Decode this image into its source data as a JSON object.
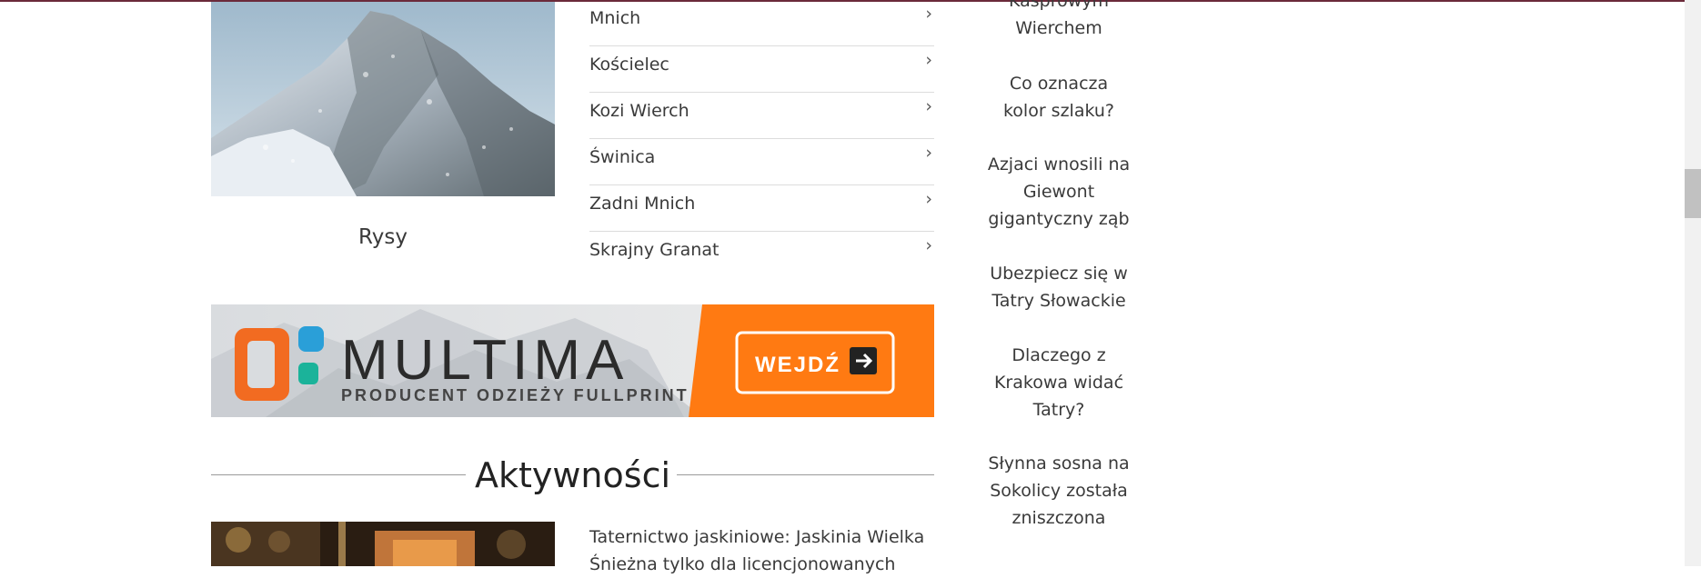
{
  "featured_peak": {
    "title": "Rysy"
  },
  "peak_list": [
    {
      "label": "Mnich"
    },
    {
      "label": "Kościelec"
    },
    {
      "label": "Kozi Wierch"
    },
    {
      "label": "Świnica"
    },
    {
      "label": "Zadni Mnich"
    },
    {
      "label": "Skrajny Granat"
    }
  ],
  "chevron_glyph": "›",
  "banner": {
    "brand": "MULTIMA",
    "tagline": "PRODUCENT ODZIEŻY FULLPRINT",
    "cta_label": "WEJDŹ",
    "accent_color": "#ff7a12"
  },
  "section": {
    "title": "Aktywności"
  },
  "article": {
    "text": "Taternictwo jaskiniowe: Jaskinia Wielka Śnieżna tylko dla licencjonowanych"
  },
  "sidebar": {
    "items": [
      {
        "lines": [
          "Kasprowym",
          "Wierchem"
        ]
      },
      {
        "lines": [
          "Co oznacza",
          "kolor szlaku?"
        ]
      },
      {
        "lines": [
          "Azjaci wnosili na",
          "Giewont",
          "gigantyczny ząb"
        ]
      },
      {
        "lines": [
          "Ubezpiecz się w",
          "Tatry Słowackie"
        ]
      },
      {
        "lines": [
          "Dlaczego z",
          "Krakowa widać",
          "Tatry?"
        ]
      },
      {
        "lines": [
          "Słynna sosna na",
          "Sokolicy została",
          "zniszczona"
        ]
      }
    ]
  }
}
